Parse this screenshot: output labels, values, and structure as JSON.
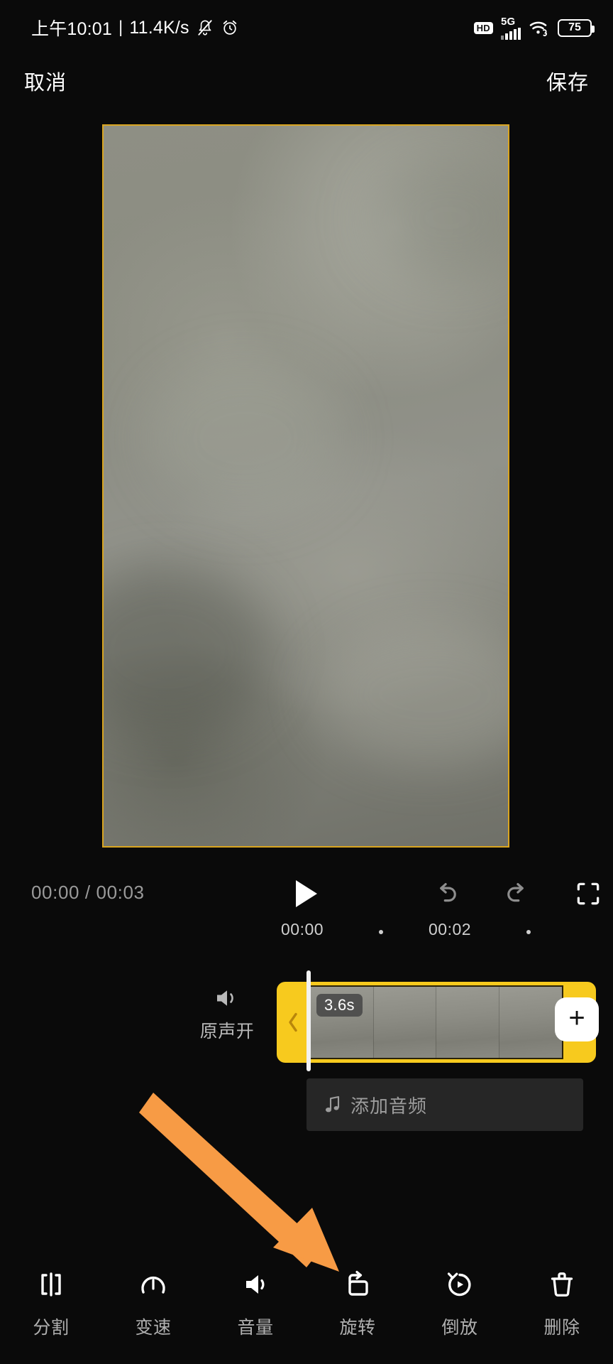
{
  "status_bar": {
    "time": "上午10:01",
    "separator": "|",
    "network_speed": "11.4K/s",
    "mute_icon": "bell-off-icon",
    "alarm_icon": "alarm-clock-icon",
    "hd_label": "HD",
    "network_type": "5G",
    "wifi_icon": "wifi-icon",
    "battery_level": "75"
  },
  "top_nav": {
    "cancel_label": "取消",
    "save_label": "保存"
  },
  "preview": {
    "border_color": "#d9a520"
  },
  "playback": {
    "current_time": "00:00",
    "separator": "/",
    "total_time": "00:03",
    "time_display": "00:00 / 00:03",
    "play_icon": "play-icon",
    "undo_icon": "undo-icon",
    "redo_icon": "redo-icon",
    "fullscreen_icon": "fullscreen-icon"
  },
  "ruler": {
    "ticks": [
      "00:00",
      "·",
      "00:02",
      "·"
    ],
    "labels": [
      "00:00",
      "00:02"
    ]
  },
  "timeline": {
    "audio_toggle": {
      "icon": "speaker-on-icon",
      "label": "原声开"
    },
    "clip": {
      "duration_badge": "3.6s",
      "left_handle_icon": "chevron-left-icon",
      "add_clip_icon": "plus-icon",
      "accent_color": "#f7ca1e",
      "thumbnail_count": 4
    },
    "audio_track": {
      "icon": "music-note-icon",
      "label": "添加音频"
    }
  },
  "annotation": {
    "arrow_color": "#f79b45",
    "points_to": "旋转"
  },
  "toolbar": {
    "items": [
      {
        "id": "split",
        "icon": "split-icon",
        "label": "分割"
      },
      {
        "id": "speed",
        "icon": "speed-icon",
        "label": "变速"
      },
      {
        "id": "volume",
        "icon": "volume-icon",
        "label": "音量"
      },
      {
        "id": "rotate",
        "icon": "rotate-icon",
        "label": "旋转"
      },
      {
        "id": "reverse",
        "icon": "reverse-icon",
        "label": "倒放"
      },
      {
        "id": "delete",
        "icon": "trash-icon",
        "label": "删除"
      }
    ]
  }
}
